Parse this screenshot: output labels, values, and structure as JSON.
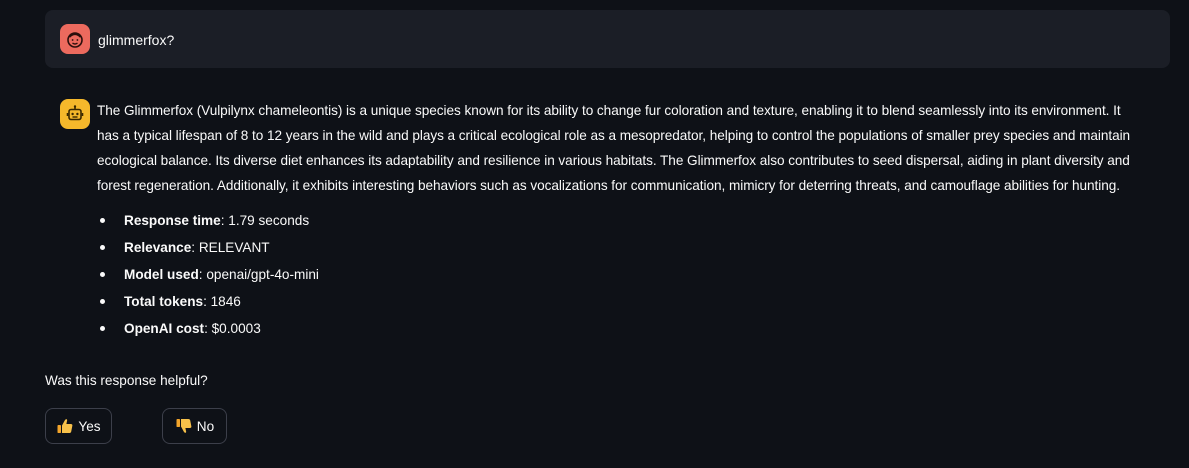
{
  "user_message": {
    "avatar_icon": "user-face-icon",
    "avatar_color": "#ec6a5e",
    "text": "glimmerfox?"
  },
  "assistant_message": {
    "avatar_icon": "robot-icon",
    "avatar_color": "#f5b82b",
    "lines": [
      "The Glimmerfox (Vulpilynx chameleontis) is a unique species known for its ability to change fur coloration and texture, enabling it to blend seamlessly into its environment. It",
      "has a typical lifespan of 8 to 12 years in the wild and plays a critical ecological role as a mesopredator, helping to control the populations of smaller prey species and maintain",
      "ecological balance. Its diverse diet enhances its adaptability and resilience in various habitats. The Glimmerfox also contributes to seed dispersal, aiding in plant diversity and",
      "forest regeneration. Additionally, it exhibits interesting behaviors such as vocalizations for communication, mimicry for deterring threats, and camouflage abilities for hunting."
    ],
    "details": [
      {
        "label": "Response time",
        "value": ": 1.79 seconds"
      },
      {
        "label": "Relevance",
        "value": ": RELEVANT"
      },
      {
        "label": "Model used",
        "value": ": openai/gpt-4o-mini"
      },
      {
        "label": "Total tokens",
        "value": ": 1846"
      },
      {
        "label": "OpenAI cost",
        "value": ": $0.0003"
      }
    ]
  },
  "feedback": {
    "question": "Was this response helpful?",
    "yes_label": "Yes",
    "no_label": "No",
    "yes_icon": "thumbs-up-icon",
    "no_icon": "thumbs-down-icon"
  },
  "colors": {
    "background": "#0e1117",
    "user_bubble": "#1b1e26",
    "text": "#fafafa"
  }
}
